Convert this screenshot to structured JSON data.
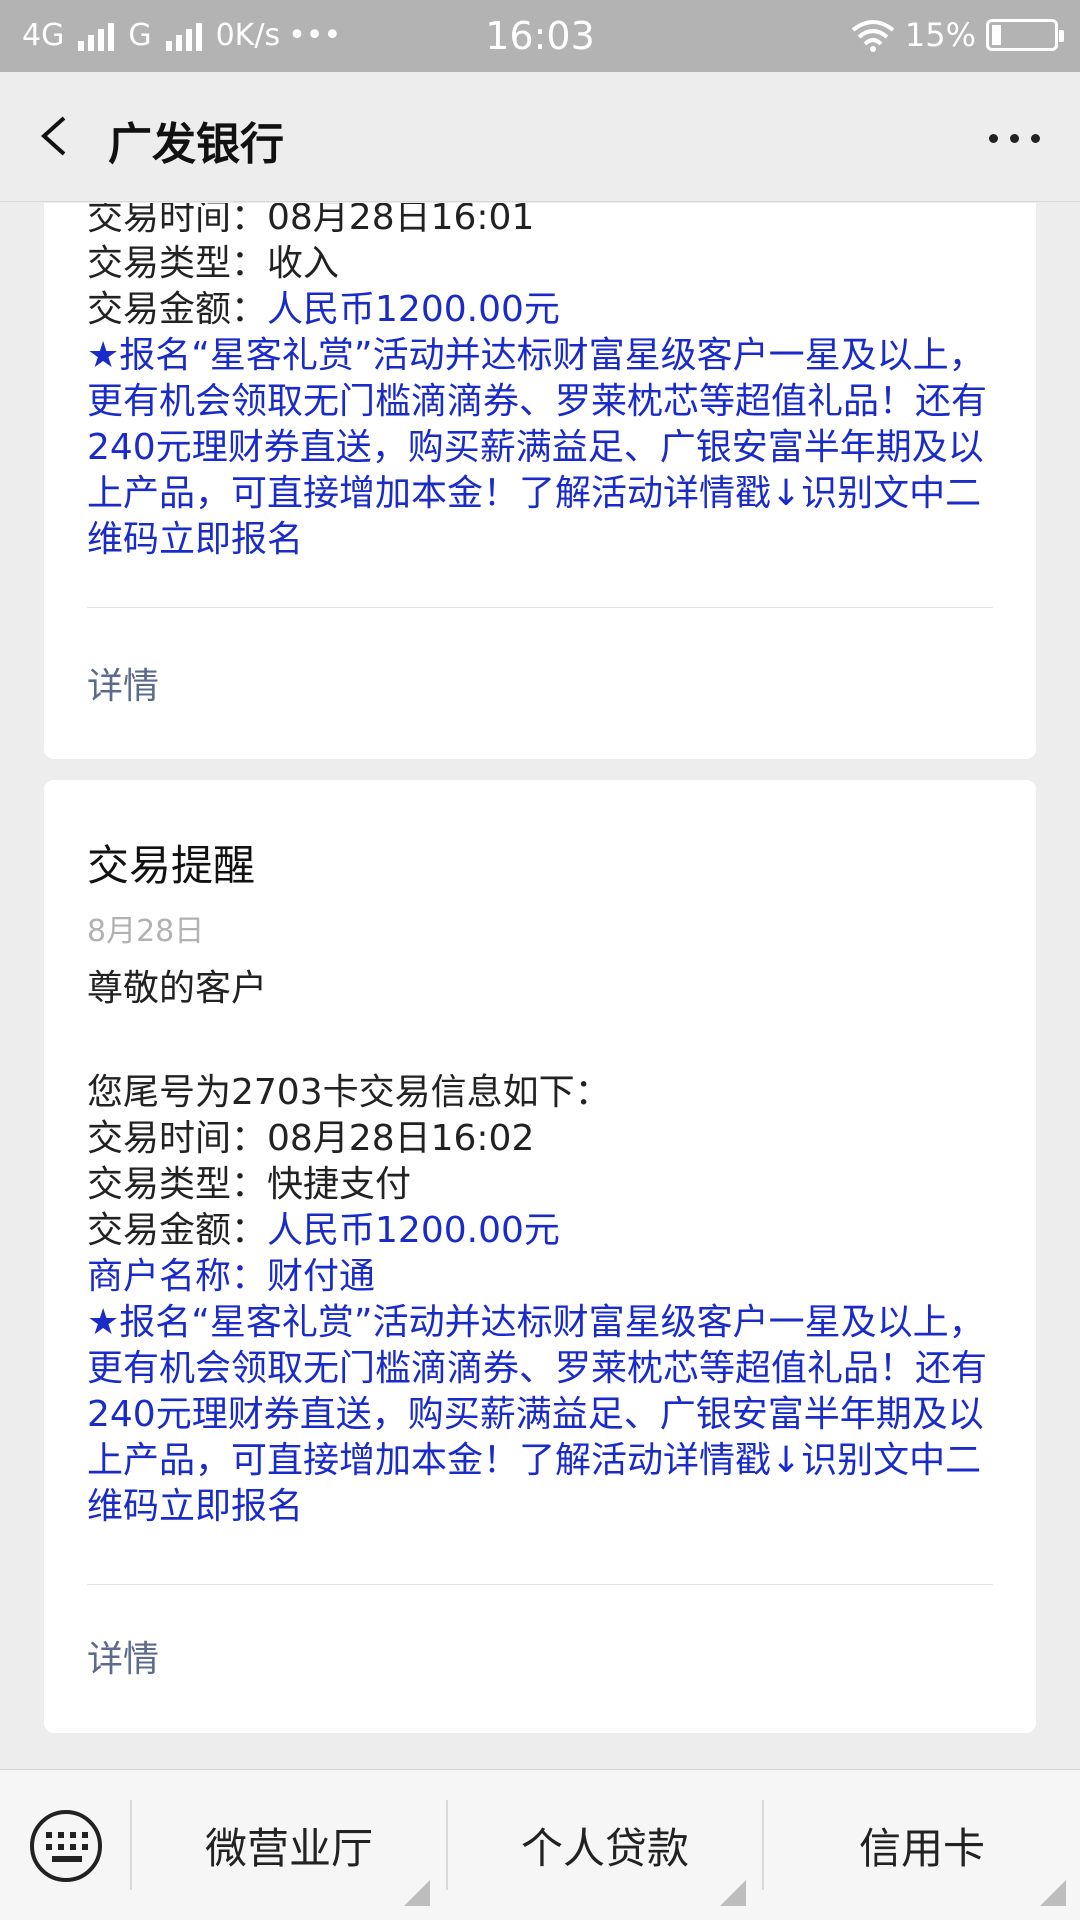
{
  "status_bar": {
    "network1": "4G",
    "network2": "G",
    "speed": "0K/s",
    "dots": "•••",
    "time": "16:03",
    "battery": "15%",
    "battery_level": 0.15
  },
  "nav": {
    "title": "广发银行"
  },
  "message1": {
    "time_line": "交易时间：08月28日16:01",
    "type_line": "交易类型：收入",
    "amount_label": "交易金额：",
    "amount_value": "人民币1200.00元",
    "promo": "★报名“星客礼赏”活动并达标财富星级客户一星及以上，更有机会领取无门槛滴滴券、罗莱枕芯等超值礼品！还有240元理财券直送，购买薪满益足、广银安富半年期及以上产品，可直接增加本金！了解活动详情戳↓识别文中二维码立即报名",
    "detail": "详情"
  },
  "message2": {
    "title": "交易提醒",
    "date": "8月28日",
    "greeting": "尊敬的客户",
    "intro": "您尾号为2703卡交易信息如下：",
    "time_line": "交易时间：08月28日16:02",
    "type_line": "交易类型：快捷支付",
    "amount_label": "交易金额：",
    "amount_value": "人民币1200.00元",
    "merchant_line": "商户名称：财付通",
    "promo": "★报名“星客礼赏”活动并达标财富星级客户一星及以上，更有机会领取无门槛滴滴券、罗莱枕芯等超值礼品！还有240元理财券直送，购买薪满益足、广银安富半年期及以上产品，可直接增加本金！了解活动详情戳↓识别文中二维码立即报名",
    "detail": "详情"
  },
  "bottom_menu": {
    "items": [
      {
        "label": "微营业厅"
      },
      {
        "label": "个人贷款"
      },
      {
        "label": "信用卡"
      }
    ]
  }
}
